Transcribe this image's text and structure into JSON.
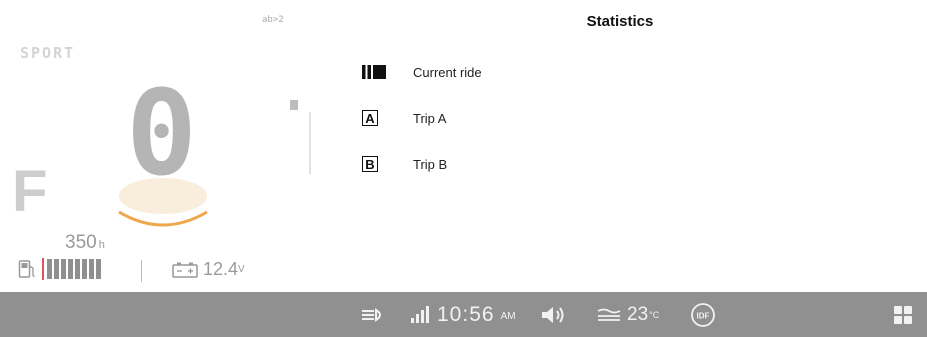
{
  "cluster": {
    "ride_mode": "SPORT",
    "top_glyph": "ab>2",
    "gear": "0",
    "fuel_letter": "F",
    "range_value": "350",
    "range_unit": "h",
    "fuel_level_bars": 8,
    "battery_voltage": "12.4",
    "battery_unit": "V",
    "colors": {
      "fuel_marker": "#e05160",
      "gear_arc": "#f0a64a"
    }
  },
  "statistics": {
    "title": "Statistics",
    "items": [
      {
        "icon": "current-ride-icon",
        "label": "Current ride"
      },
      {
        "icon": "trip-a-icon",
        "letter": "A",
        "label": "Trip A"
      },
      {
        "icon": "trip-b-icon",
        "letter": "B",
        "label": "Trip B"
      }
    ]
  },
  "status_bar": {
    "background": "#909090",
    "time": "10:56",
    "ampm": "AM",
    "temperature": "23",
    "temperature_unit": "°C",
    "icons": [
      "headlight-icon",
      "signal-icon",
      "volume-icon",
      "road-temperature-icon",
      "idf-icon",
      "apps-grid-icon"
    ],
    "idf_label": "IDF"
  }
}
